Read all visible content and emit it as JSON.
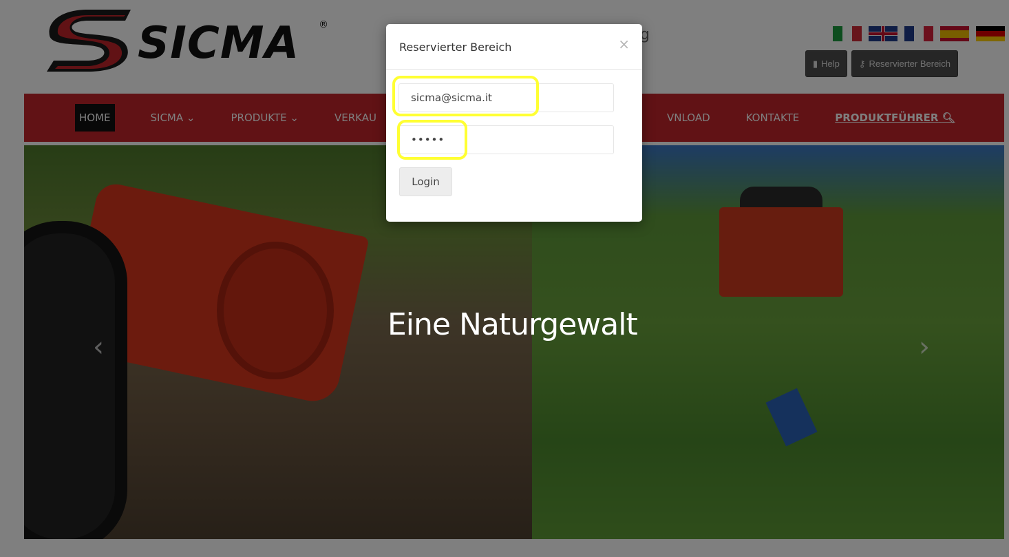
{
  "header": {
    "logo_text": "SICMA",
    "logo_reg": "®",
    "tagline": "g",
    "flags": [
      "italian-flag",
      "uk-flag",
      "french-flag",
      "spanish-flag",
      "german-flag"
    ],
    "help_label": "Help",
    "reserved_label": "Reservierter Bereich"
  },
  "nav": {
    "items": [
      "HOME",
      "SICMA",
      "PRODUKTE",
      "VERKAU",
      "VNLOAD",
      "KONTAKTE",
      "PRODUKTFÜHRER"
    ],
    "chevron": "⌄"
  },
  "hero": {
    "caption": "Eine Naturgewalt",
    "prev_arrow": "‹",
    "next_arrow": "›"
  },
  "modal": {
    "title": "Reservierter Bereich",
    "close": "×",
    "email_value": "sicma@sicma.it",
    "password_value": "•••••",
    "login_label": "Login"
  },
  "colors": {
    "nav_red": "#c3242b",
    "highlight": "#ffff33"
  }
}
